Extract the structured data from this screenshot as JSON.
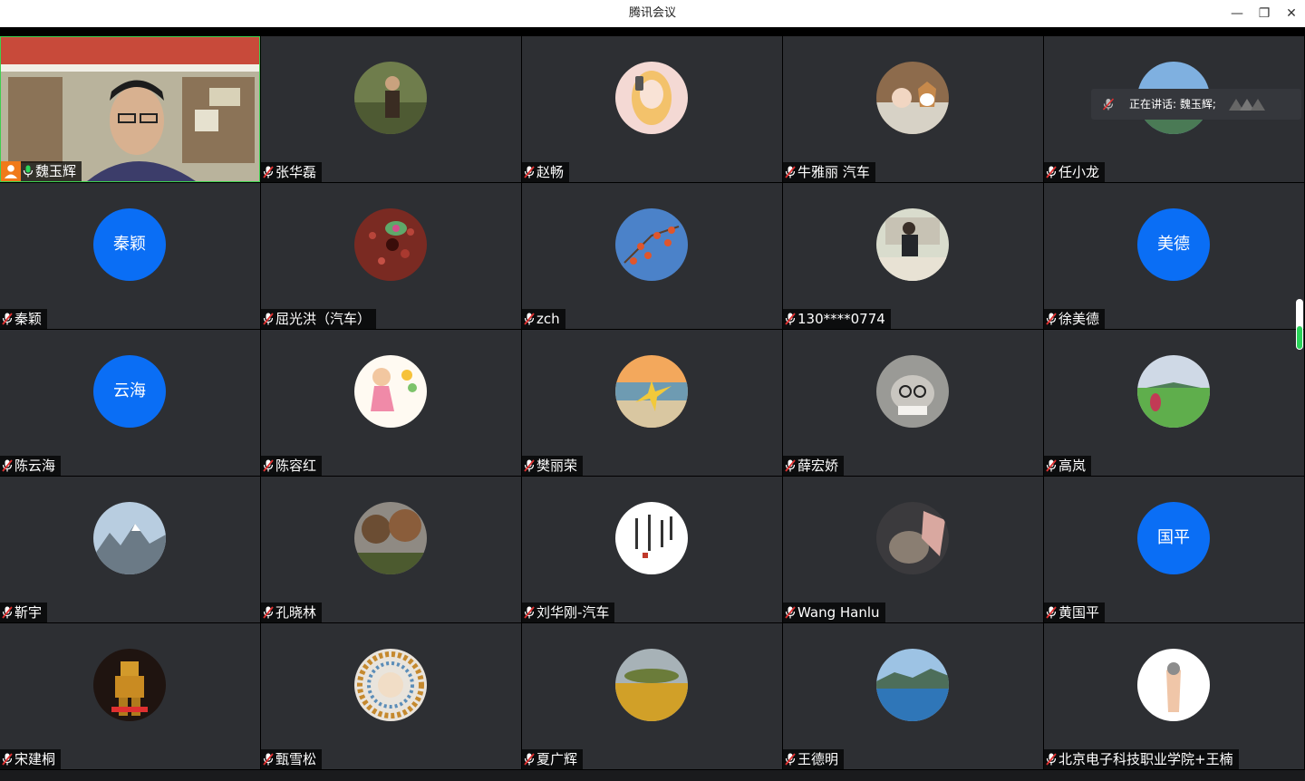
{
  "window": {
    "title": "腾讯会议",
    "minimize_glyph": "—",
    "restore_glyph": "❐",
    "close_glyph": "✕"
  },
  "speaking_indicator": {
    "label": "正在讲话: 魏玉辉;"
  },
  "colors": {
    "tile_bg": "#2d2f33",
    "avatar_blue": "#0a6ef5",
    "active_border": "#3ecf4f",
    "muted_red": "#e03030"
  },
  "participants": [
    {
      "name": "魏玉辉",
      "type": "video",
      "mic": "on",
      "host": true
    },
    {
      "name": "张华磊",
      "type": "photo",
      "mic": "muted",
      "photo": "man-outdoors"
    },
    {
      "name": "赵畅",
      "type": "photo",
      "mic": "muted",
      "photo": "anime-girl"
    },
    {
      "name": "牛雅丽 汽车",
      "type": "photo",
      "mic": "muted",
      "photo": "baby-and-dog"
    },
    {
      "name": "任小龙",
      "type": "photo",
      "mic": "muted",
      "photo": "lake-sky"
    },
    {
      "name": "秦颖",
      "type": "text",
      "avatar_text": "秦颖",
      "mic": "muted"
    },
    {
      "name": "屈光洪（汽车）",
      "type": "photo",
      "mic": "muted",
      "photo": "flower-leaves"
    },
    {
      "name": "zch",
      "type": "photo",
      "mic": "muted",
      "photo": "persimmons-sky"
    },
    {
      "name": "130****0774",
      "type": "photo",
      "mic": "muted",
      "photo": "man-at-desk"
    },
    {
      "name": "徐美德",
      "type": "text",
      "avatar_text": "美德",
      "mic": "muted"
    },
    {
      "name": "陈云海",
      "type": "text",
      "avatar_text": "云海",
      "mic": "muted"
    },
    {
      "name": "陈容红",
      "type": "photo",
      "mic": "muted",
      "photo": "cartoon-girl"
    },
    {
      "name": "樊丽荣",
      "type": "photo",
      "mic": "muted",
      "photo": "dancer-beach"
    },
    {
      "name": "薛宏娇",
      "type": "photo",
      "mic": "muted",
      "photo": "cat-glasses"
    },
    {
      "name": "高岚",
      "type": "photo",
      "mic": "muted",
      "photo": "woman-grassland"
    },
    {
      "name": "靳宇",
      "type": "photo",
      "mic": "muted",
      "photo": "mountains"
    },
    {
      "name": "孔晓林",
      "type": "photo",
      "mic": "muted",
      "photo": "autumn-trees"
    },
    {
      "name": "刘华刚-汽车",
      "type": "photo",
      "mic": "muted",
      "photo": "calligraphy"
    },
    {
      "name": "Wang Hanlu",
      "type": "photo",
      "mic": "muted",
      "photo": "cat-hand"
    },
    {
      "name": "黄国平",
      "type": "text",
      "avatar_text": "国平",
      "mic": "muted"
    },
    {
      "name": "宋建桐",
      "type": "photo",
      "mic": "muted",
      "photo": "robot-gold"
    },
    {
      "name": "甄雪松",
      "type": "photo",
      "mic": "muted",
      "photo": "mandala-face"
    },
    {
      "name": "夏广辉",
      "type": "photo",
      "mic": "muted",
      "photo": "golden-field"
    },
    {
      "name": "王德明",
      "type": "photo",
      "mic": "muted",
      "photo": "sea-coast"
    },
    {
      "name": "北京电子科技职业学院+王楠",
      "type": "photo",
      "mic": "muted",
      "photo": "hand-gesture"
    }
  ]
}
